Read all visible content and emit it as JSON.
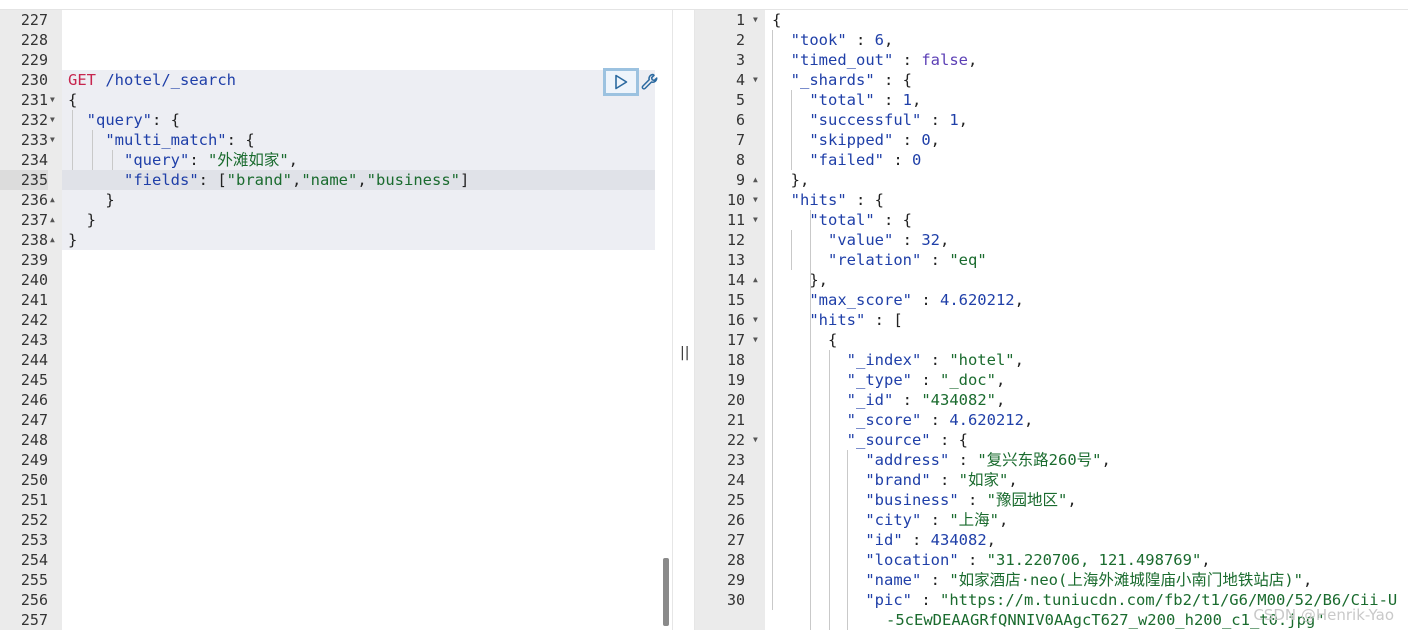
{
  "editor": {
    "line_numbers": [
      "227",
      "228",
      "229",
      "230",
      "231",
      "232",
      "233",
      "234",
      "235",
      "236",
      "237",
      "238",
      "239",
      "240",
      "241",
      "242",
      "243",
      "244",
      "245",
      "246",
      "247",
      "248",
      "249",
      "250",
      "251",
      "252",
      "253",
      "254",
      "255",
      "256",
      "257"
    ],
    "request": {
      "method": "GET",
      "path": " /hotel/_search",
      "open_brace": "{",
      "query_key": "\"query\"",
      "multi_match_key": "\"multi_match\"",
      "inner_query_key": "\"query\"",
      "inner_query_value": "\"外滩如家\"",
      "fields_key": "\"fields\"",
      "fields_values": [
        "\"brand\"",
        "\"name\"",
        "\"business\""
      ],
      "close_brace": "}"
    },
    "run_icon": "play-icon",
    "settings_icon": "wrench-icon"
  },
  "response": {
    "line_numbers": [
      "1",
      "2",
      "3",
      "4",
      "5",
      "6",
      "7",
      "8",
      "9",
      "10",
      "11",
      "12",
      "13",
      "14",
      "15",
      "16",
      "17",
      "18",
      "19",
      "20",
      "21",
      "22",
      "23",
      "24",
      "25",
      "26",
      "27",
      "28",
      "29",
      "30"
    ],
    "took": "\"took\"",
    "took_val": "6",
    "timed_out": "\"timed_out\"",
    "timed_out_val": "false",
    "shards": "\"_shards\"",
    "total": "\"total\"",
    "total_val": "1",
    "successful": "\"successful\"",
    "successful_val": "1",
    "skipped": "\"skipped\"",
    "skipped_val": "0",
    "failed": "\"failed\"",
    "failed_val": "0",
    "hits": "\"hits\"",
    "value": "\"value\"",
    "value_val": "32",
    "relation": "\"relation\"",
    "relation_val": "\"eq\"",
    "max_score": "\"max_score\"",
    "max_score_val": "4.620212",
    "index": "\"_index\"",
    "index_val": "\"hotel\"",
    "type": "\"_type\"",
    "type_val": "\"_doc\"",
    "id_key": "\"_id\"",
    "id_val": "\"434082\"",
    "score": "\"_score\"",
    "score_val": "4.620212",
    "source": "\"_source\"",
    "address": "\"address\"",
    "address_val": "\"复兴东路260号\"",
    "brand": "\"brand\"",
    "brand_val": "\"如家\"",
    "business": "\"business\"",
    "business_val": "\"豫园地区\"",
    "city": "\"city\"",
    "city_val": "\"上海\"",
    "sid": "\"id\"",
    "sid_val": "434082",
    "location": "\"location\"",
    "location_val": "\"31.220706, 121.498769\"",
    "name": "\"name\"",
    "name_val": "\"如家酒店·neo(上海外滩城隍庙小南门地铁站店)\"",
    "pic": "\"pic\"",
    "pic_val": "\"https://m.tuniucdn.com/fb2/t1/G6/M00/52/B6/Cii-U",
    "pic_cont": "-5cEwDEAAGRfQNNIV0AAgcT627_w200_h200_c1_t0.jpg\""
  },
  "divider_grip": "||",
  "watermark": "CSDN @Henrik-Yao"
}
